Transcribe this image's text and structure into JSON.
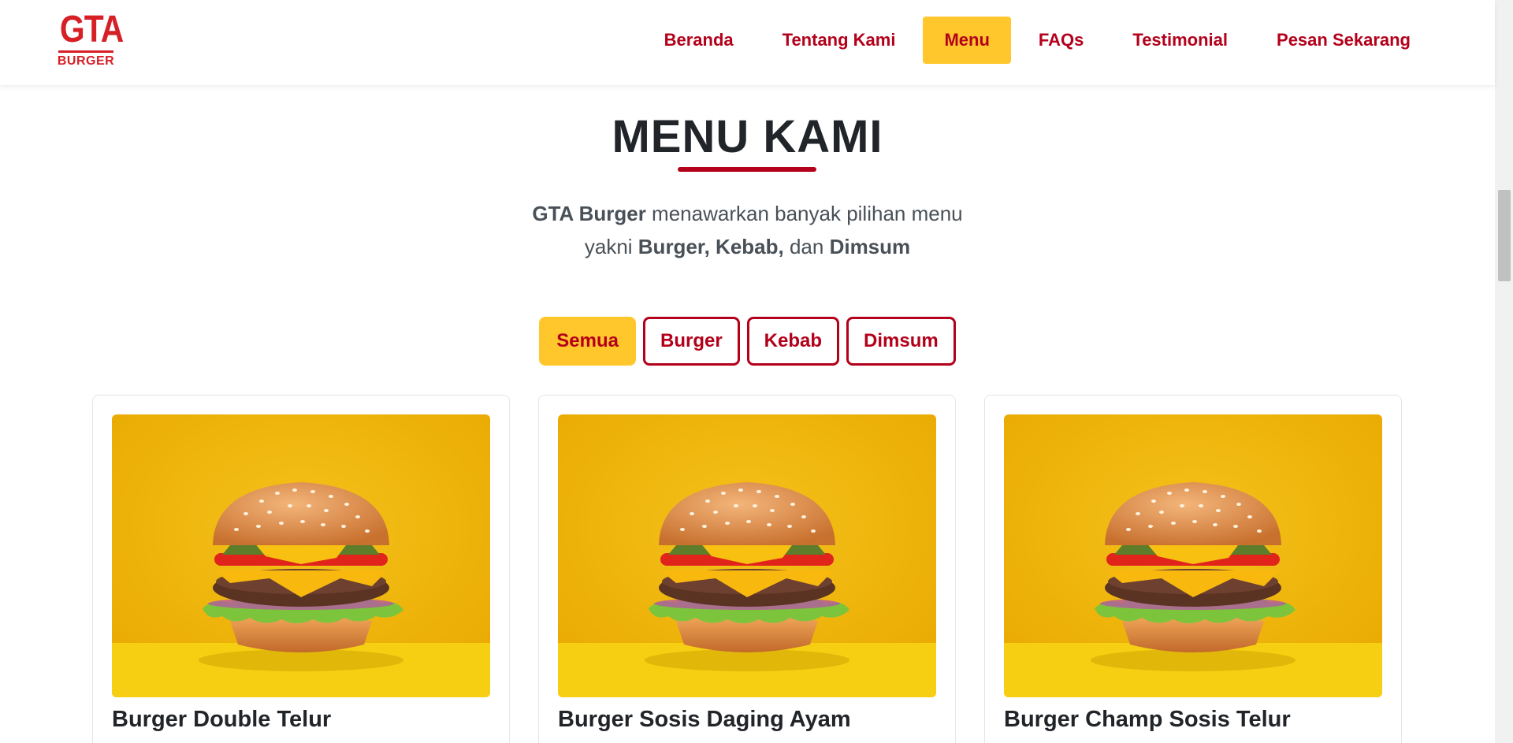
{
  "brand": {
    "logo_main": "GTA",
    "logo_sub": "BURGER"
  },
  "nav": [
    {
      "label": "Beranda",
      "active": false
    },
    {
      "label": "Tentang Kami",
      "active": false
    },
    {
      "label": "Menu",
      "active": true
    },
    {
      "label": "FAQs",
      "active": false
    },
    {
      "label": "Testimonial",
      "active": false
    },
    {
      "label": "Pesan Sekarang",
      "active": false
    }
  ],
  "section": {
    "title": "MENU KAMI",
    "lead": {
      "brand": "GTA Burger",
      "text1": " menawarkan banyak pilihan menu",
      "text2": "yakni ",
      "item1": "Burger,",
      "item2": "Kebab,",
      "text3": " dan ",
      "item3": "Dimsum"
    }
  },
  "filters": [
    {
      "label": "Semua",
      "active": true
    },
    {
      "label": "Burger",
      "active": false
    },
    {
      "label": "Kebab",
      "active": false
    },
    {
      "label": "Dimsum",
      "active": false
    }
  ],
  "products": [
    {
      "name": "Burger Double Telur",
      "image": "burger-image"
    },
    {
      "name": "Burger Sosis Daging Ayam",
      "image": "burger-image"
    },
    {
      "name": "Burger Champ Sosis Telur",
      "image": "burger-image"
    }
  ],
  "colors": {
    "brand_red": "#b3001b",
    "logo_red": "#d71f26",
    "accent_yellow": "#ffc72c",
    "text_dark": "#212529"
  }
}
